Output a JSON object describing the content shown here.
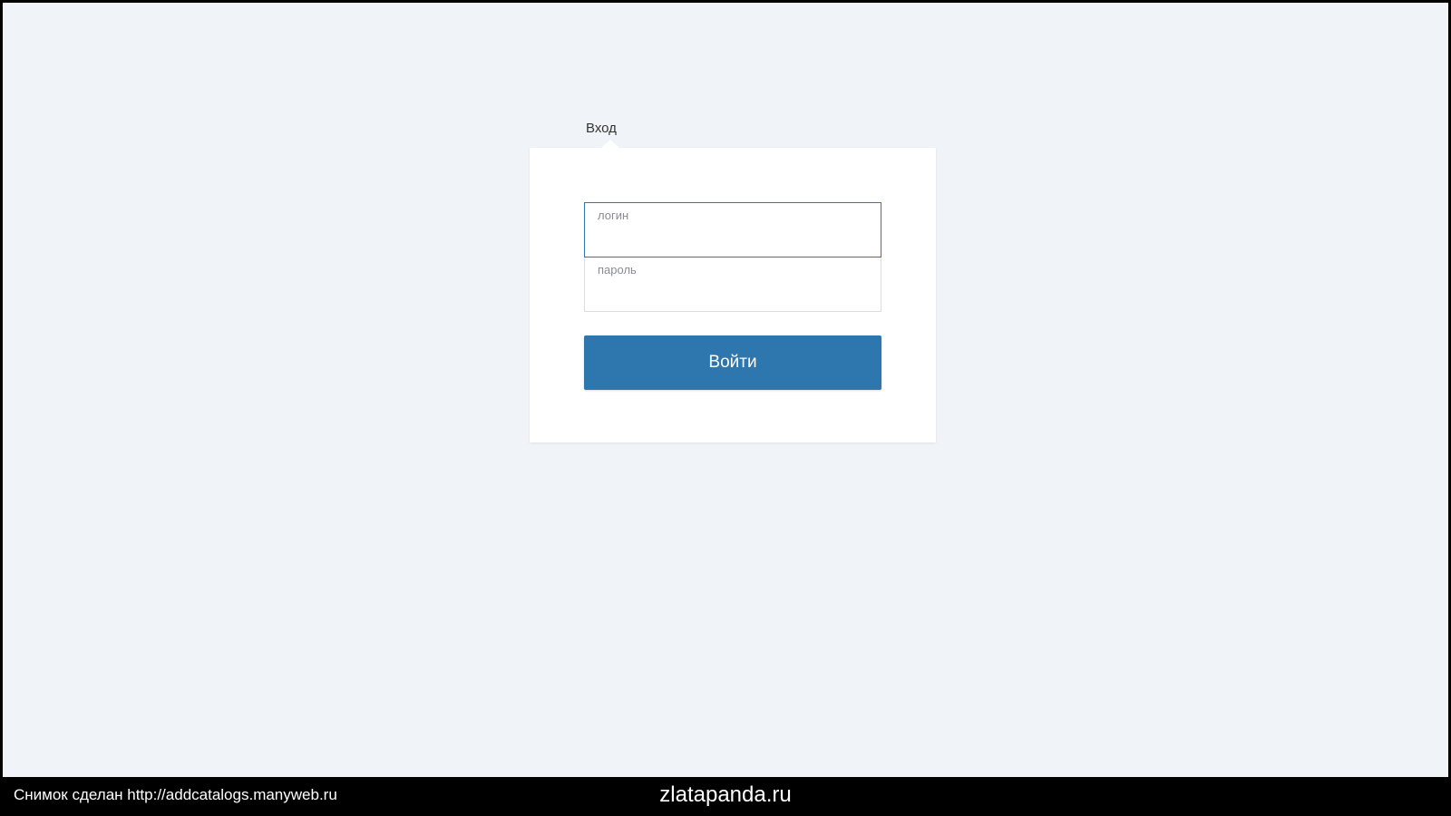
{
  "page": {
    "title": "Вход"
  },
  "form": {
    "login_label": "логин",
    "login_value": "",
    "password_label": "пароль",
    "password_value": "",
    "submit_label": "Войти"
  },
  "footer": {
    "left_text": "Снимок сделан http://addcatalogs.manyweb.ru",
    "center_text": "zlatapanda.ru"
  }
}
